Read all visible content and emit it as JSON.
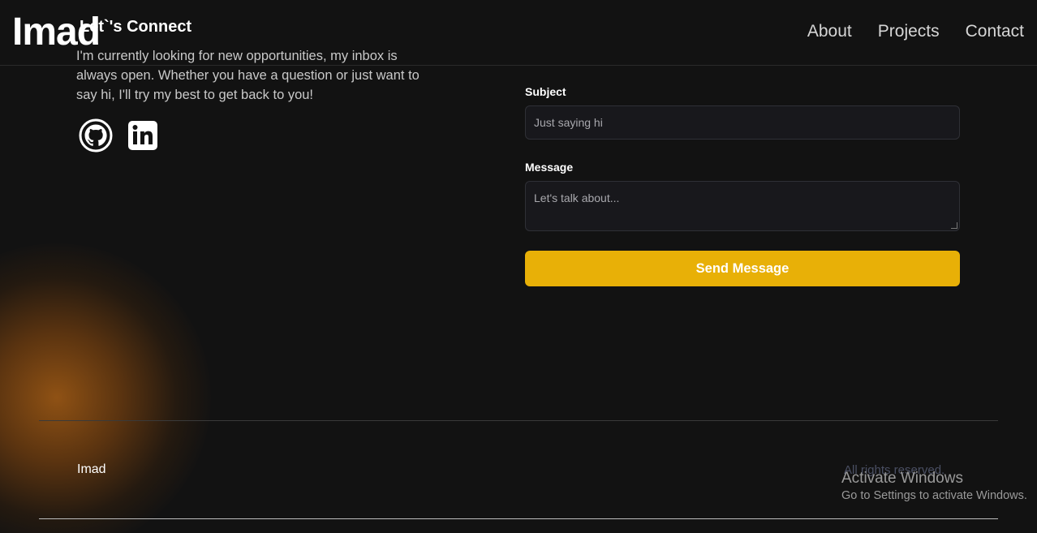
{
  "navbar": {
    "logo": "Imad",
    "links": [
      "About",
      "Projects",
      "Contact"
    ]
  },
  "contact": {
    "title": "Let`'s Connect",
    "description": "I'm currently looking for new opportunities, my inbox is always open. Whether you have a question or just want to say hi, I'll try my best to get back to you!",
    "socials": [
      {
        "name": "GitHub",
        "icon": "github-icon"
      },
      {
        "name": "LinkedIn",
        "icon": "linkedin-icon"
      }
    ]
  },
  "form": {
    "subject_label": "Subject",
    "subject_placeholder": "Just saying hi",
    "message_label": "Message",
    "message_placeholder": "Let's talk about...",
    "send_label": "Send Message",
    "button_color": "#e8b007"
  },
  "footer": {
    "name": "Imad",
    "rights": "All rights reserved."
  },
  "windows_watermark": {
    "title": "Activate Windows",
    "subtitle": "Go to Settings to activate Windows."
  }
}
